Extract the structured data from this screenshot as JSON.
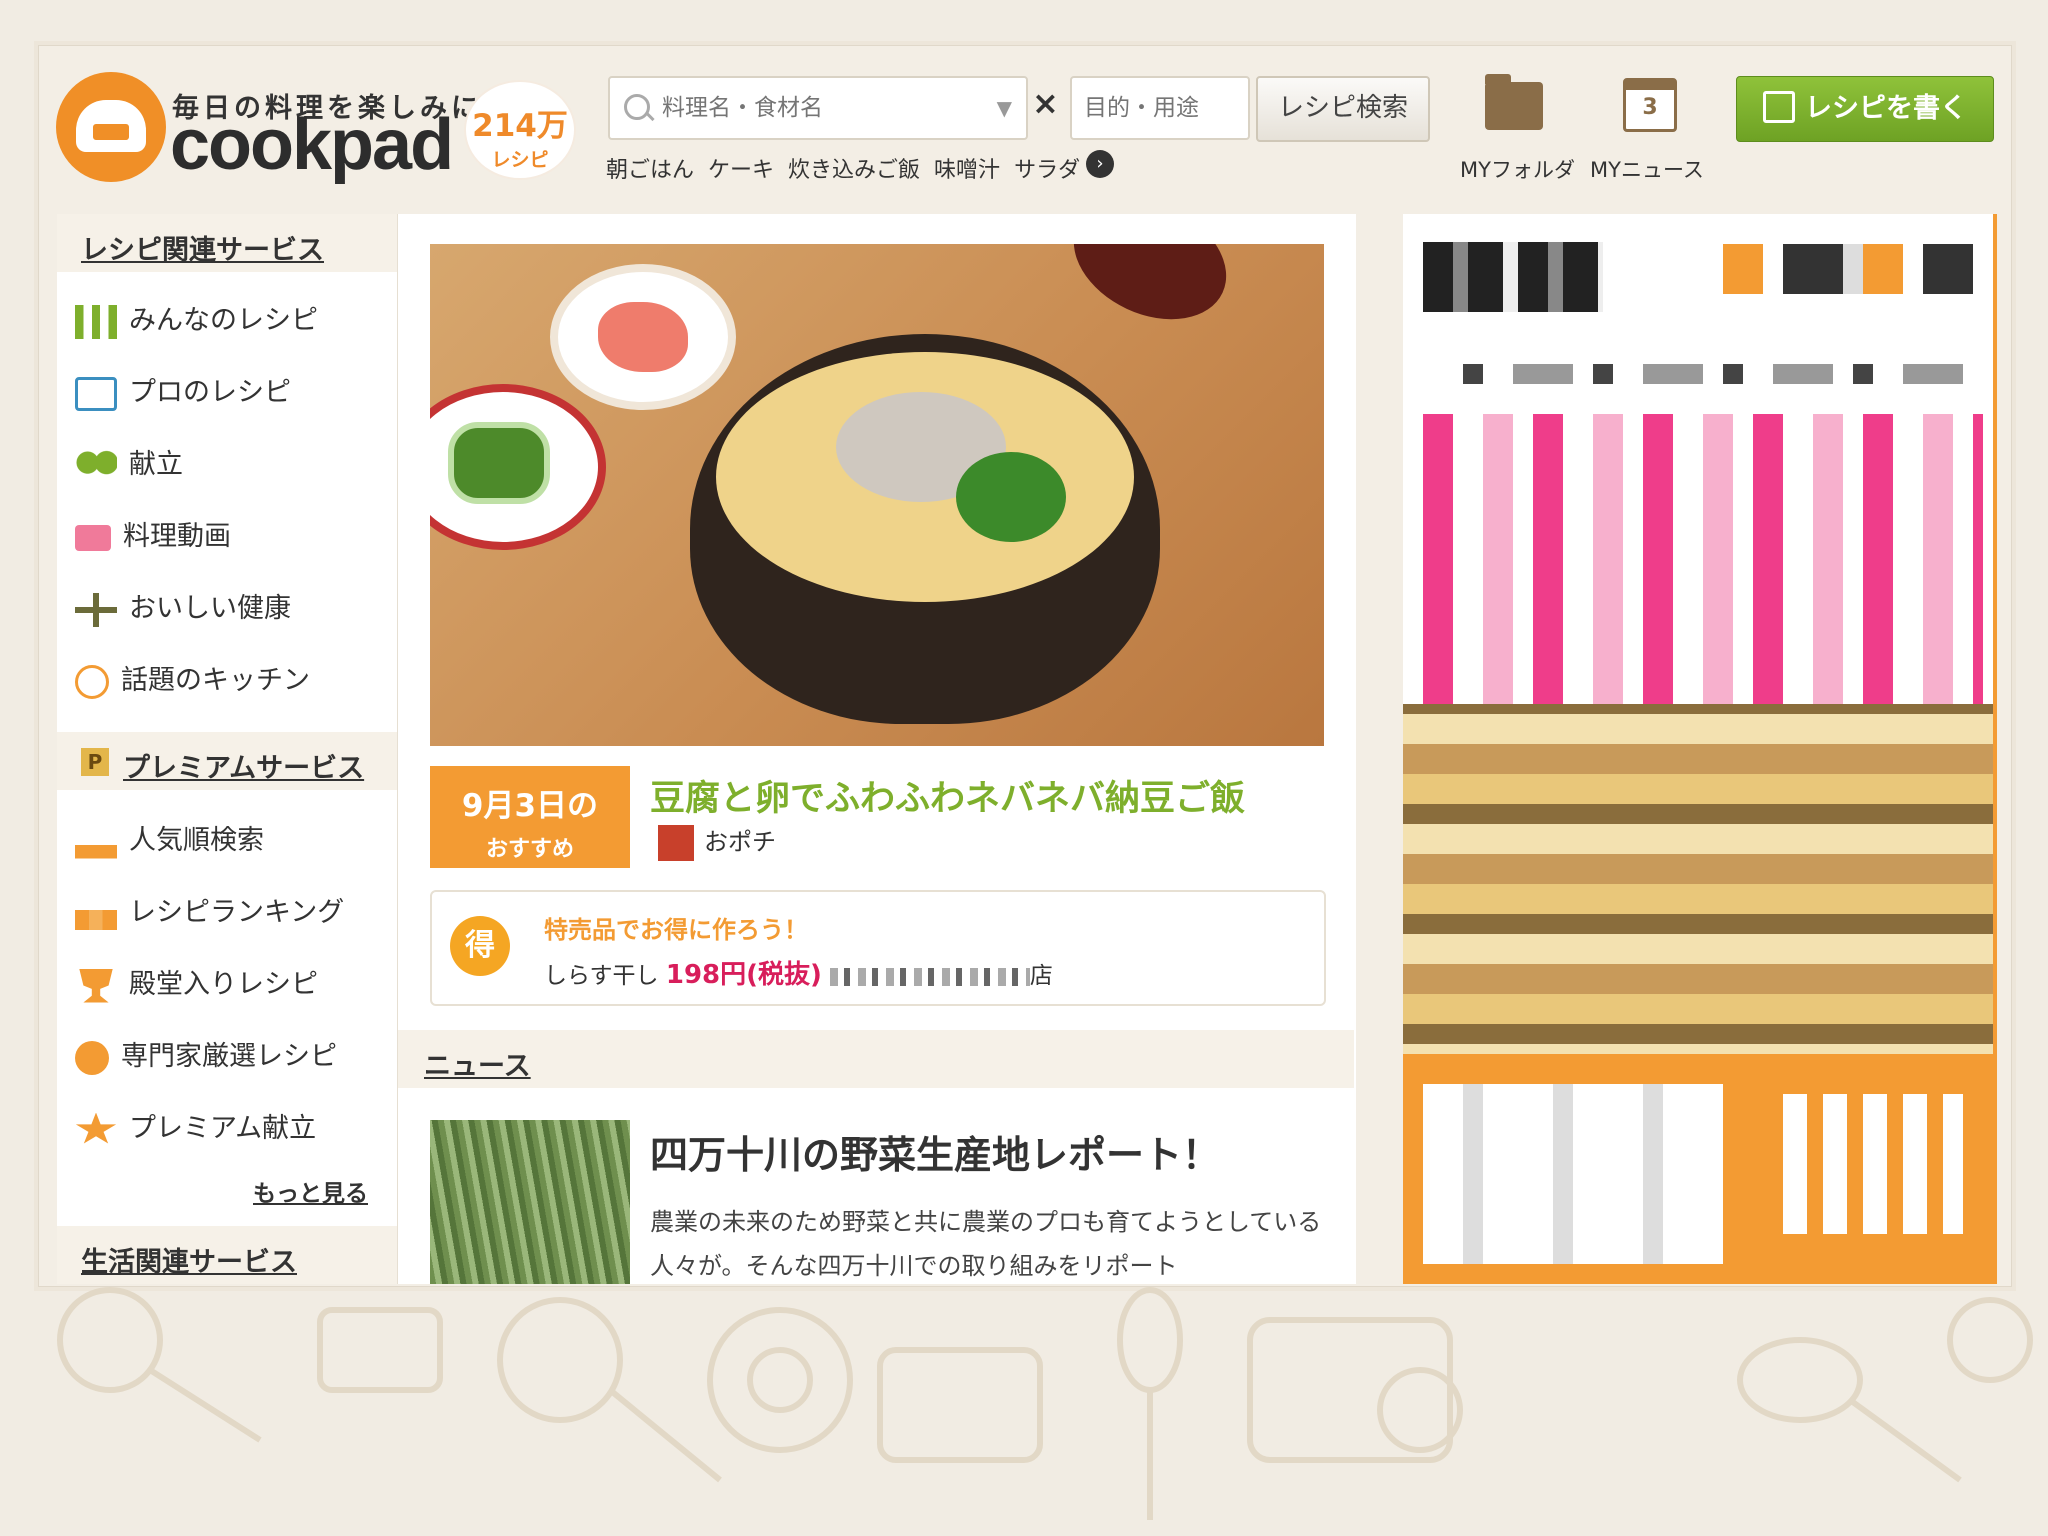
{
  "header": {
    "tagline": "毎日の料理を楽しみに",
    "brand": "cookpad",
    "recipe_count": "214万",
    "recipe_unit": "レシピ",
    "search_placeholder": "料理名・食材名",
    "times": "×",
    "purpose_placeholder": "目的・用途",
    "search_button": "レシピ検索",
    "keywords": [
      "朝ごはん",
      "ケーキ",
      "炊き込みご飯",
      "味噌汁",
      "サラダ"
    ],
    "my_folder": "MYフォルダ",
    "my_news": "MYニュース",
    "my_news_badge": "3",
    "write_button": "レシピを書く"
  },
  "sidebar": {
    "section1": "レシピ関連サービス",
    "items1": [
      "みんなのレシピ",
      "プロのレシピ",
      "献立",
      "料理動画",
      "おいしい健康",
      "話題のキッチン"
    ],
    "section2": "プレミアムサービス",
    "items2": [
      "人気順検索",
      "レシピランキング",
      "殿堂入りレシピ",
      "専門家厳選レシピ",
      "プレミアム献立"
    ],
    "more": "もっと見る",
    "section3": "生活関連サービス"
  },
  "featured": {
    "date": "9月3日の",
    "date_sub": "おすすめ",
    "title": "豆腐と卵でふわふわネバネバ納豆ご飯",
    "author": "おポチ"
  },
  "deal": {
    "icon": "得",
    "title": "特売品でお得に作ろう！",
    "item": "しらす干し",
    "price": "198円(税抜)",
    "store_suffix": "店"
  },
  "news": {
    "heading": "ニュース",
    "title": "四万十川の野菜生産地レポート！",
    "text": "農業の未来のため野菜と共に農業のプロも育てようとしている人々が。そんな四万十川での取り組みをリポート"
  },
  "colors": {
    "brand_orange": "#f39b33",
    "accent_green": "#7eaf2c",
    "price_pink": "#d81e5b"
  }
}
